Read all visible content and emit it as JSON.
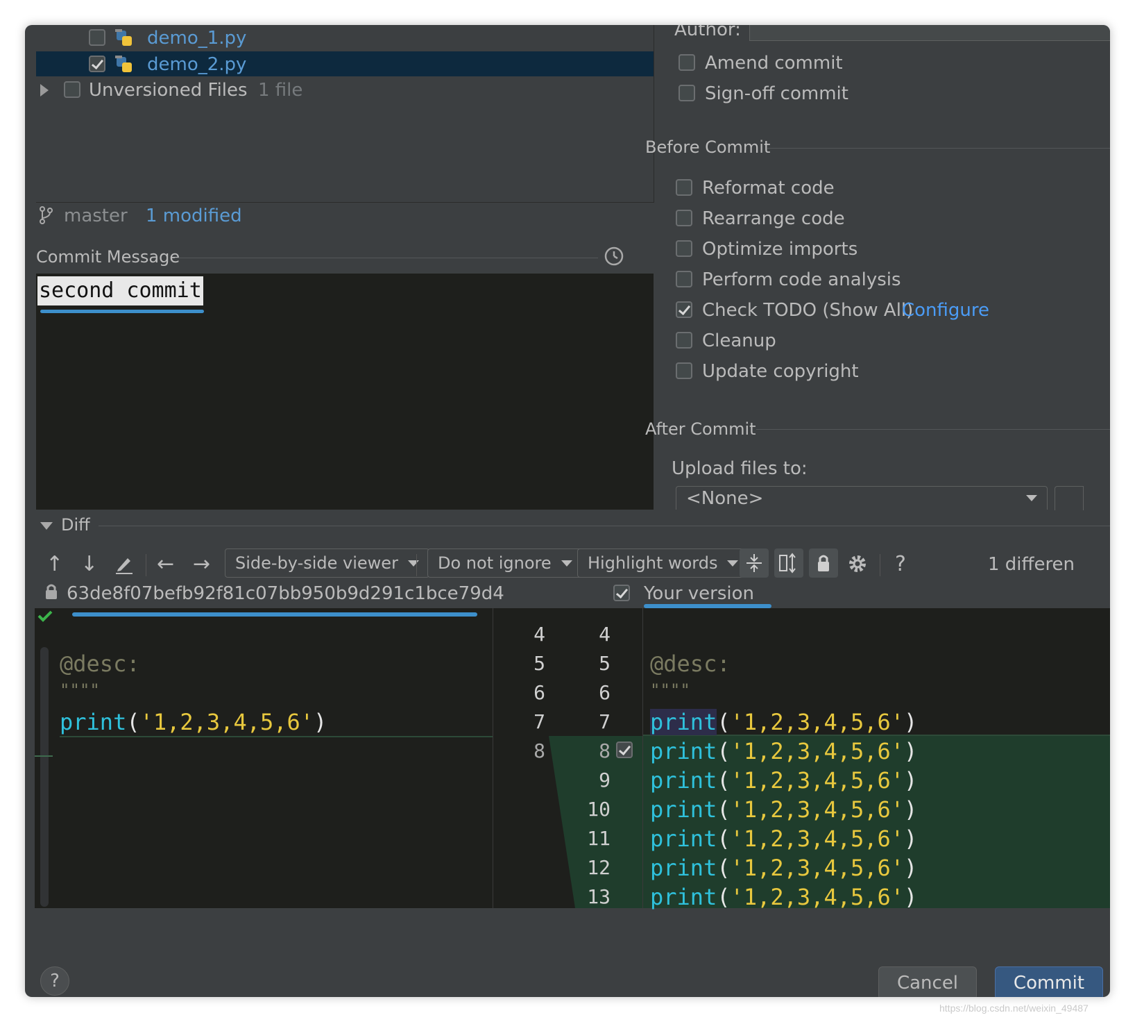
{
  "changes": {
    "files": [
      {
        "name": "demo_1.py",
        "checked": false
      },
      {
        "name": "demo_2.py",
        "checked": true
      }
    ],
    "unversioned": {
      "label": "Unversioned Files",
      "count": "1 file"
    },
    "branch": "master",
    "modified": "1 modified"
  },
  "commit_message": {
    "label": "Commit Message",
    "value": "second commit"
  },
  "options": {
    "author_label": "Author:",
    "amend": "Amend commit",
    "signoff": "Sign-off commit",
    "before_commit": {
      "title": "Before Commit",
      "items": [
        {
          "label": "Reformat code",
          "checked": false
        },
        {
          "label": "Rearrange code",
          "checked": false
        },
        {
          "label": "Optimize imports",
          "checked": false
        },
        {
          "label": "Perform code analysis",
          "checked": false
        },
        {
          "label": "Check TODO (Show All)",
          "checked": true
        },
        {
          "label": "Cleanup",
          "checked": false
        },
        {
          "label": "Update copyright",
          "checked": false
        }
      ],
      "configure_link": "Configure"
    },
    "after_commit": {
      "title": "After Commit",
      "upload_label": "Upload files to:",
      "upload_value": "<None>"
    }
  },
  "diff": {
    "title": "Diff",
    "viewer": "Side-by-side viewer",
    "ignore": "Do not ignore",
    "highlight": "Highlight words",
    "differences": "1 differen",
    "left_revision": "63de8f07befb92f81c07bb950b9d291c1bce79d4",
    "right_title": "Your version",
    "left_lines": [
      "4",
      "5",
      "6",
      "7",
      "8"
    ],
    "right_lines": [
      "4",
      "5",
      "6",
      "7",
      "8",
      "9",
      "10",
      "11",
      "12",
      "13"
    ],
    "left_code": {
      "desc": "@desc:",
      "quotes": "\"\"\"\"",
      "print_kw": "print",
      "print_open": "(",
      "print_str": "'1,2,3,4,5,6'",
      "print_close": ")"
    }
  },
  "buttons": {
    "help": "?",
    "cancel": "Cancel",
    "commit": "Commit"
  },
  "watermark": "https://blog.csdn.net/weixin_49487"
}
